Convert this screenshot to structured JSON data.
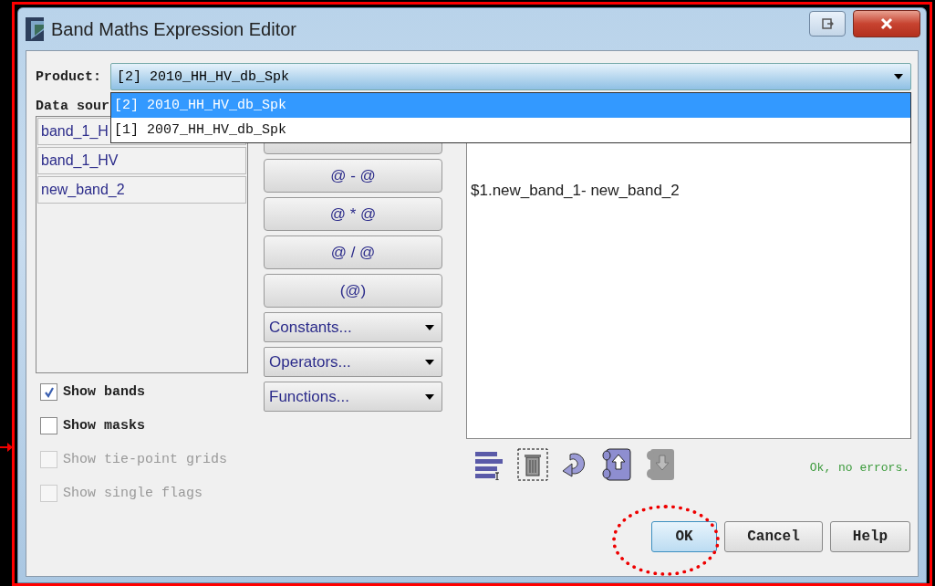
{
  "window": {
    "title": "Band Maths Expression Editor"
  },
  "product": {
    "label": "Product:",
    "value": "[2] 2010_HH_HV_db_Spk"
  },
  "product_options": [
    {
      "label": "[2] 2010_HH_HV_db_Spk",
      "selected": true
    },
    {
      "label": "[1] 2007_HH_HV_db_Spk",
      "selected": false
    }
  ],
  "data_sources": {
    "label": "Data sour",
    "items": [
      "band_1_H",
      "band_1_HV",
      "new_band_2"
    ]
  },
  "operators": [
    {
      "kind": "button"
    },
    {
      "kind": "button",
      "label": "@ - @"
    },
    {
      "kind": "button",
      "label": "@ * @"
    },
    {
      "kind": "button",
      "label": "@ / @"
    },
    {
      "kind": "button",
      "label": "(@)"
    },
    {
      "kind": "menu",
      "label": "Constants..."
    },
    {
      "kind": "menu",
      "label": "Operators..."
    },
    {
      "kind": "menu",
      "label": "Functions..."
    }
  ],
  "options": [
    {
      "label": "Show bands",
      "checked": true,
      "disabled": false
    },
    {
      "label": "Show masks",
      "checked": false,
      "disabled": false
    },
    {
      "label": "Show tie-point grids",
      "checked": false,
      "disabled": true
    },
    {
      "label": "Show single flags",
      "checked": false,
      "disabled": true
    }
  ],
  "expression": "$1.new_band_1- new_band_2",
  "status": "Ok, no errors.",
  "buttons": [
    {
      "label": "OK",
      "default": true
    },
    {
      "label": "Cancel",
      "default": false
    },
    {
      "label": "Help",
      "default": false
    }
  ]
}
